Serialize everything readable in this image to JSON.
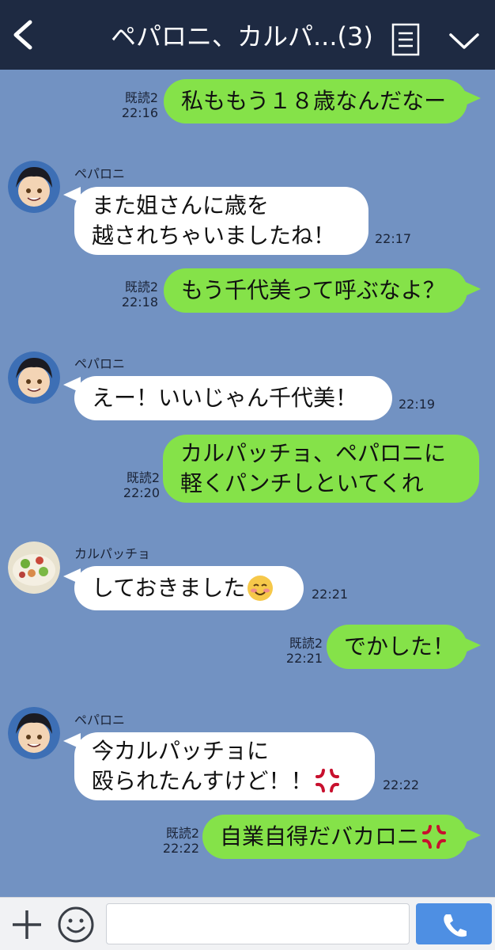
{
  "header": {
    "title": "ペパロニ、カルパ...(3)",
    "back_icon": "chevron-left-icon",
    "menu_icon": "list-menu-icon",
    "collapse_icon": "chevron-down-icon",
    "background": "#1e2a42"
  },
  "chat": {
    "background": "#7292c2",
    "outgoing_color": "#85e249",
    "incoming_color": "#ffffff"
  },
  "messages": [
    {
      "direction": "out",
      "read": "既読2",
      "time": "22:16",
      "text": "私ももう１８歳なんだなー"
    },
    {
      "direction": "in",
      "sender": "ペパロニ",
      "time": "22:17",
      "text": "また姐さんに歳を\n越されちゃいましたね！"
    },
    {
      "direction": "out",
      "read": "既読2",
      "time": "22:18",
      "text": "もう千代美って呼ぶなよ？"
    },
    {
      "direction": "in",
      "sender": "ペパロニ",
      "time": "22:19",
      "text": "えー！いいじゃん千代美！"
    },
    {
      "direction": "out",
      "read": "既読2",
      "time": "22:20",
      "text": "カルパッチョ、ペパロニに\n軽くパンチしといてくれ"
    },
    {
      "direction": "in",
      "sender": "カルパッチョ",
      "time": "22:21",
      "text": "しておきました",
      "emoji": "blushing-smile-emoji"
    },
    {
      "direction": "out",
      "read": "既読2",
      "time": "22:21",
      "text": "でかした！"
    },
    {
      "direction": "in",
      "sender": "ペパロニ",
      "time": "22:22",
      "text": "今カルパッチョに\n殴られたんすけど！！",
      "emoji": "anger-symbol-emoji"
    },
    {
      "direction": "out",
      "read": "既読2",
      "time": "22:22",
      "text": "自業自得だバカロニ",
      "emoji": "anger-symbol-emoji"
    }
  ],
  "input_bar": {
    "plus_icon": "plus-icon",
    "sticker_icon": "smiley-icon",
    "placeholder": "",
    "call_icon": "phone-icon",
    "call_color": "#4e8fe3"
  }
}
